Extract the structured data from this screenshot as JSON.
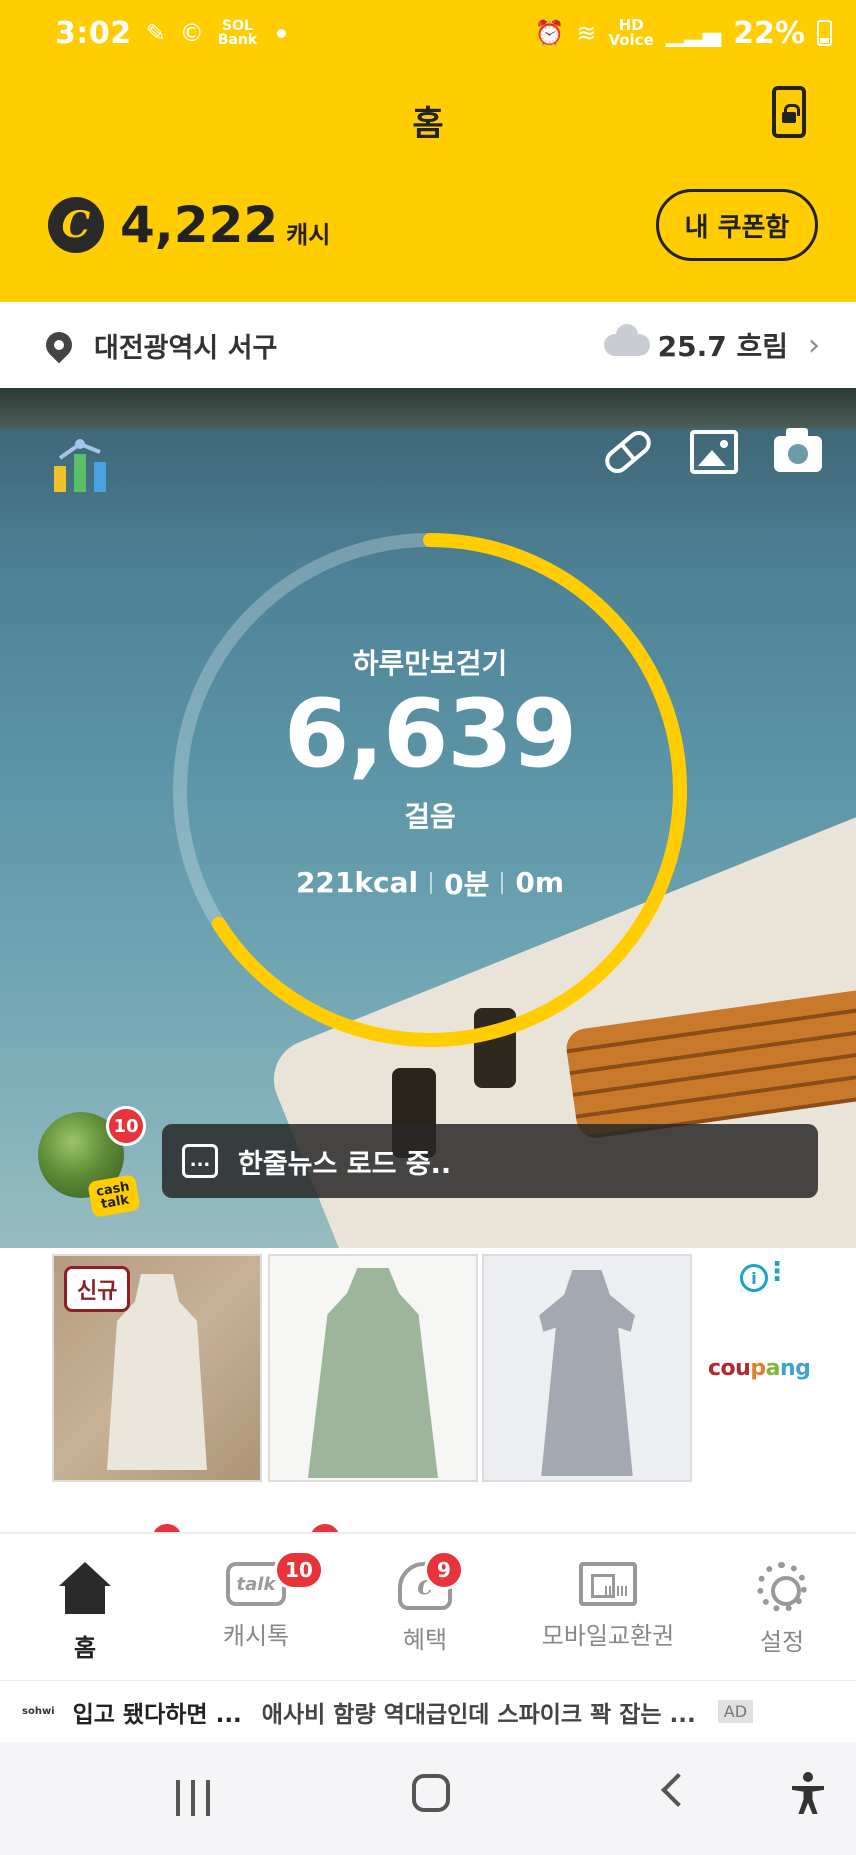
{
  "status_bar": {
    "time": "3:02",
    "left_icons": [
      "wind-hiking-icon",
      "cash-sol-icon"
    ],
    "sol_label": "SOL",
    "sol_bank": "Bank",
    "hd_voice_top": "HD",
    "hd_voice_bottom": "Voice",
    "battery": "22%"
  },
  "header": {
    "title": "홈",
    "cash_symbol": "C",
    "cash_amount": "4,222",
    "cash_unit": "캐시",
    "coupon_button": "내 쿠폰함"
  },
  "location": {
    "place": "대전광역시 서구",
    "weather": "25.7 흐림",
    "chevron": "›"
  },
  "pedometer": {
    "label": "하루만보걷기",
    "steps": "6,639",
    "steps_unit": "걸음",
    "kcal": "221kcal",
    "minutes": "0분",
    "distance": "0m",
    "goal_progress": 0.66
  },
  "cashtalk": {
    "badge": "10",
    "sticker_line1": "cash",
    "sticker_line2": "talk",
    "news_icon_glyph": "...",
    "news_text": "한줄뉴스 로드 중.."
  },
  "ad_banner": {
    "new_badge": "신규",
    "info_glyph": "i",
    "more_glyph": "⋮",
    "brand": [
      "cou",
      "p",
      "a",
      "ng"
    ]
  },
  "bottom_nav": [
    {
      "label": "홈",
      "badge": ""
    },
    {
      "label": "캐시톡",
      "badge": "10",
      "icon_text": "talk"
    },
    {
      "label": "혜택",
      "badge": "9",
      "icon_text": "c"
    },
    {
      "label": "모바일교환권",
      "badge": ""
    },
    {
      "label": "설정",
      "badge": ""
    }
  ],
  "text_ad": {
    "brand": "sohwi",
    "title": "입고 됐다하면 ...",
    "description": "애사비 함량 역대급인데 스파이크 꽉 잡는 ...",
    "tag": "AD"
  },
  "colors": {
    "brand_yellow": "#ffcd00",
    "badge_red": "#e8333a",
    "ring_track": "rgba(255,255,255,0.25)"
  }
}
